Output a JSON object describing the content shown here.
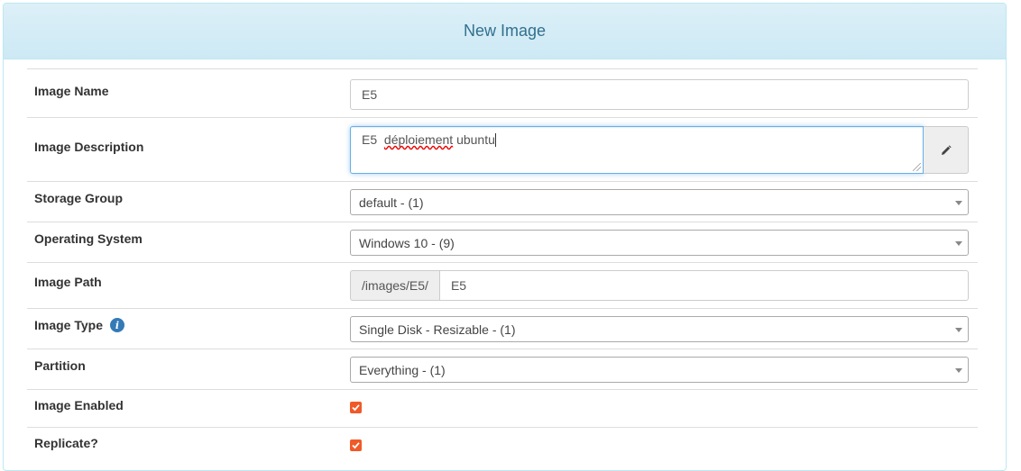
{
  "panel": {
    "title": "New Image"
  },
  "fields": {
    "image_name": {
      "label": "Image Name",
      "value": "E5"
    },
    "image_description": {
      "label": "Image Description",
      "value_prefix": "E5  ",
      "value_misspelled": "déploiement",
      "value_suffix": " ubuntu",
      "edit_icon": "pencil-icon"
    },
    "storage_group": {
      "label": "Storage Group",
      "selected": "default - (1)"
    },
    "operating_system": {
      "label": "Operating System",
      "selected": "Windows 10 - (9)"
    },
    "image_path": {
      "label": "Image Path",
      "prefix": "/images/E5/",
      "value": "E5"
    },
    "image_type": {
      "label": "Image Type",
      "selected": "Single Disk - Resizable - (1)",
      "help_icon": "info-icon"
    },
    "partition": {
      "label": "Partition",
      "selected": "Everything - (1)"
    },
    "image_enabled": {
      "label": "Image Enabled",
      "checked": true
    },
    "replicate": {
      "label": "Replicate?",
      "checked": true
    }
  },
  "colors": {
    "accent": "#f05a28",
    "heading_text": "#31708f",
    "heading_bg": "#d9eef7",
    "info": "#337ab7"
  }
}
